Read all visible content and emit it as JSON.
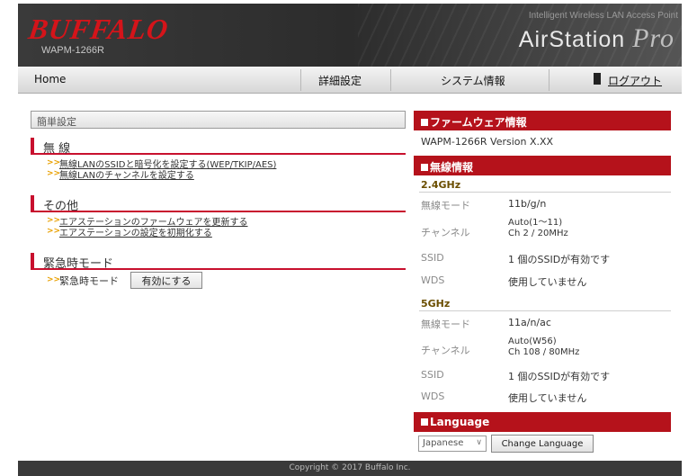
{
  "header": {
    "logo": "BUFFALO",
    "model": "WAPM-1266R",
    "tagline": "Intelligent Wireless LAN Access Point",
    "brand_main": "AirStation",
    "brand_pro": "Pro"
  },
  "nav": {
    "home": "Home",
    "advanced": "詳細設定",
    "system_info": "システム情報",
    "logout": "ログアウト"
  },
  "left": {
    "header": "簡単設定",
    "wireless_title": "無 線",
    "wireless_link1": "無線LANのSSIDと暗号化を設定する(WEP/TKIP/AES)",
    "wireless_link2": "無線LANのチャンネルを設定する",
    "other_title": "その他",
    "other_link1": "エアステーションのファームウェアを更新する",
    "other_link2": "エアステーションの設定を初期化する",
    "emergency_title": "緊急時モード",
    "emergency_label": "緊急時モード",
    "emergency_button": "有効にする",
    "arrow": ">>"
  },
  "right": {
    "firmware_title": "ファームウェア情報",
    "firmware_version": "WAPM-1266R Version X.XX",
    "wireless_title": "無線情報",
    "band_24": {
      "name": "2.4GHz",
      "mode_label": "無線モード",
      "mode_value": "11b/g/n",
      "channel_label": "チャンネル",
      "channel_value_1": "Auto(1〜11)",
      "channel_value_2": "Ch 2 / 20MHz",
      "ssid_label": "SSID",
      "ssid_value": "1 個のSSIDが有効です",
      "wds_label": "WDS",
      "wds_value": "使用していません"
    },
    "band_5": {
      "name": "5GHz",
      "mode_label": "無線モード",
      "mode_value": "11a/n/ac",
      "channel_label": "チャンネル",
      "channel_value_1": "Auto(W56)",
      "channel_value_2": "Ch 108 / 80MHz",
      "ssid_label": "SSID",
      "ssid_value": "1 個のSSIDが有効です",
      "wds_label": "WDS",
      "wds_value": "使用していません"
    },
    "language_title": "Language",
    "language_selected": "Japanese",
    "language_button": "Change Language"
  },
  "footer": {
    "copyright": "Copyright © 2017 Buffalo Inc."
  },
  "colors": {
    "accent_red": "#b5121b",
    "header_dark": "#2c2c2c",
    "link_arrow": "#e8a000"
  }
}
